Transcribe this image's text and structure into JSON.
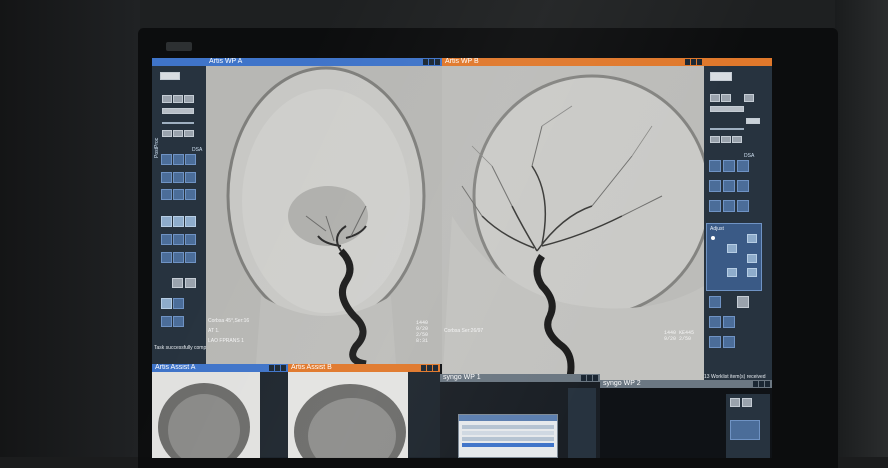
{
  "panels": {
    "top_left": {
      "title": "Artis WP A"
    },
    "top_right": {
      "title": "Artis WP B"
    },
    "bottom_1": {
      "title": "Artis Assist A"
    },
    "bottom_2": {
      "title": "Artis Assist B"
    },
    "bottom_3": {
      "title": "syngo WP 1"
    },
    "bottom_4": {
      "title": "syngo WP 2"
    }
  },
  "left_sidebar": {
    "vertical_label": "PostProc",
    "dsa_label": "DSA",
    "status": "Task successfully complete."
  },
  "right_sidebar": {
    "dsa_label": "DSA",
    "adjust_label": "Adjust",
    "status": "13 Worklist item(s) received"
  },
  "overlays": {
    "wp_a_lower_left": "Corbsa 45°,Ser:16",
    "wp_a_lower_left_2": "AT 1.",
    "wp_a_lower_left_3": "LAO FPRANS 1",
    "wp_a_lower_right": "1440\n9/20\n2/50\n8:31",
    "wp_b_lower_left": "Corbsa Ser:26/97",
    "wp_b_lower_right": "1440 KE445\n9/20 2/50"
  },
  "colors": {
    "blue_header": "#3f74c9",
    "orange_header": "#e0782b",
    "button_blue": "#4b6d99"
  }
}
